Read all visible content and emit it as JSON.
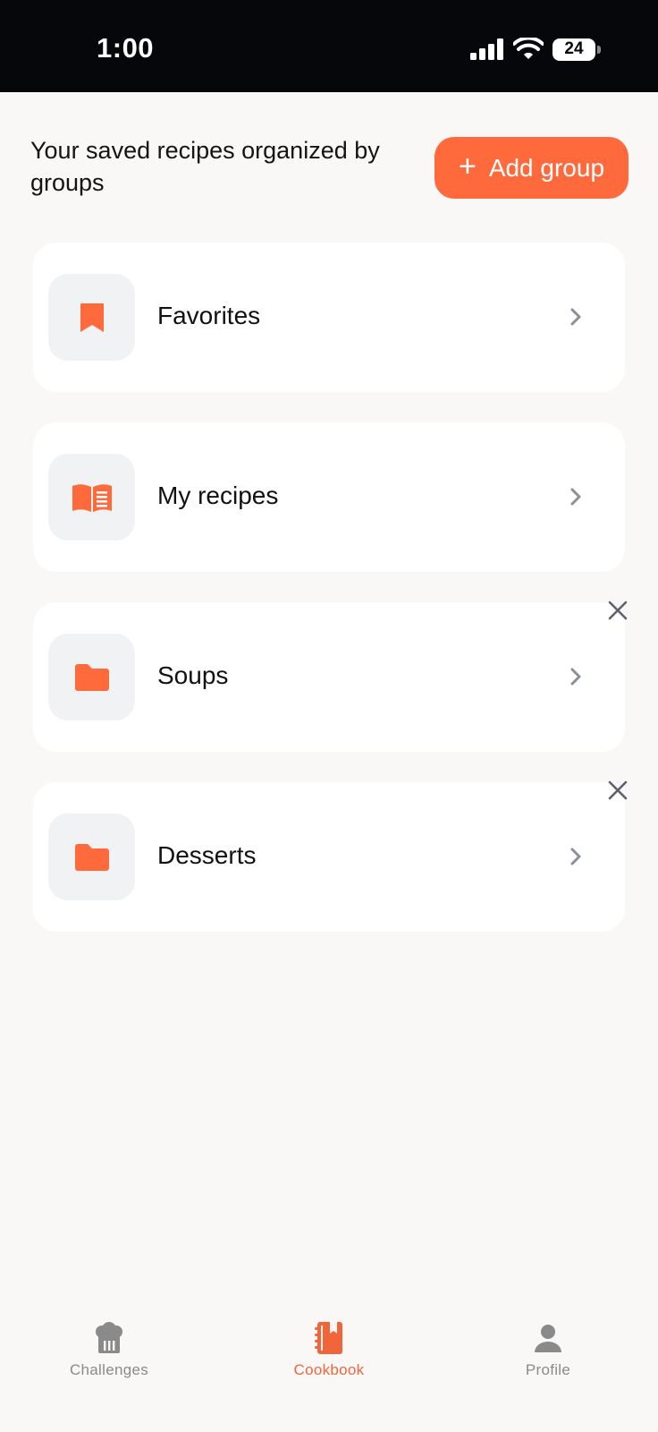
{
  "status_bar": {
    "time": "1:00",
    "battery": "24"
  },
  "header": {
    "description": "Your saved recipes organized by groups",
    "add_group_label": "Add group",
    "add_group_plus": "+"
  },
  "groups": [
    {
      "label": "Favorites",
      "icon": "bookmark-icon",
      "removable": false
    },
    {
      "label": "My recipes",
      "icon": "open-book-icon",
      "removable": false
    },
    {
      "label": "Soups",
      "icon": "folder-icon",
      "removable": true
    },
    {
      "label": "Desserts",
      "icon": "folder-icon",
      "removable": true
    }
  ],
  "tabs": [
    {
      "label": "Challenges",
      "icon": "chef-hat-icon",
      "active": false
    },
    {
      "label": "Cookbook",
      "icon": "cookbook-icon",
      "active": true
    },
    {
      "label": "Profile",
      "icon": "person-icon",
      "active": false
    }
  ],
  "colors": {
    "accent": "#ff6a3d",
    "background": "#f9f8f7",
    "card": "#ffffff",
    "icon_tile": "#f1f2f4",
    "inactive": "#8a8a8a"
  }
}
